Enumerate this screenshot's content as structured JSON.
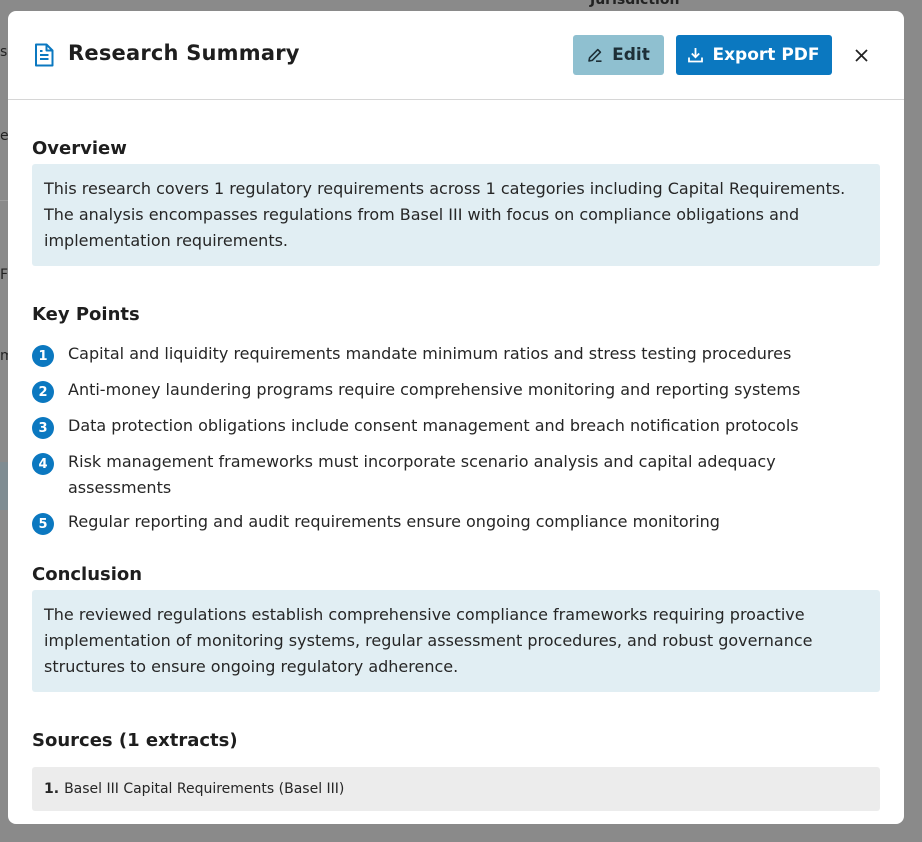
{
  "background": {
    "fragment_top": "Jurisdiction",
    "fragment_s": "s",
    "fragment_er": "er",
    "fragment_fo": "Fo",
    "fragment_m": "m"
  },
  "modal": {
    "title": "Research Summary",
    "title_icon": "document-icon",
    "edit_label": "Edit",
    "edit_icon": "pencil-icon",
    "export_label": "Export PDF",
    "export_icon": "download-icon",
    "close_icon": "close-icon"
  },
  "overview": {
    "heading": "Overview",
    "text": "This research covers 1 regulatory requirements across 1 categories including Capital Requirements. The analysis encompasses regulations from Basel III with focus on compliance obligations and implementation requirements."
  },
  "key_points": {
    "heading": "Key Points",
    "items": [
      {
        "num": "1",
        "text": "Capital and liquidity requirements mandate minimum ratios and stress testing procedures"
      },
      {
        "num": "2",
        "text": "Anti-money laundering programs require comprehensive monitoring and reporting systems"
      },
      {
        "num": "3",
        "text": "Data protection obligations include consent management and breach notification protocols"
      },
      {
        "num": "4",
        "text": "Risk management frameworks must incorporate scenario analysis and capital adequacy assessments"
      },
      {
        "num": "5",
        "text": "Regular reporting and audit requirements ensure ongoing compliance monitoring"
      }
    ]
  },
  "conclusion": {
    "heading": "Conclusion",
    "text": "The reviewed regulations establish comprehensive compliance frameworks requiring proactive implementation of monitoring systems, regular assessment procedures, and robust governance structures to ensure ongoing regulatory adherence."
  },
  "sources": {
    "heading": "Sources (1 extracts)",
    "items": [
      {
        "index": "1.",
        "text": "Basel III Capital Requirements (Basel III)"
      }
    ]
  },
  "colors": {
    "accent": "#0b78c0",
    "edit_button": "#8fc0d0",
    "info_box": "#e1eef3",
    "source_box": "#ececec",
    "overlay": "#8a8a8a"
  }
}
